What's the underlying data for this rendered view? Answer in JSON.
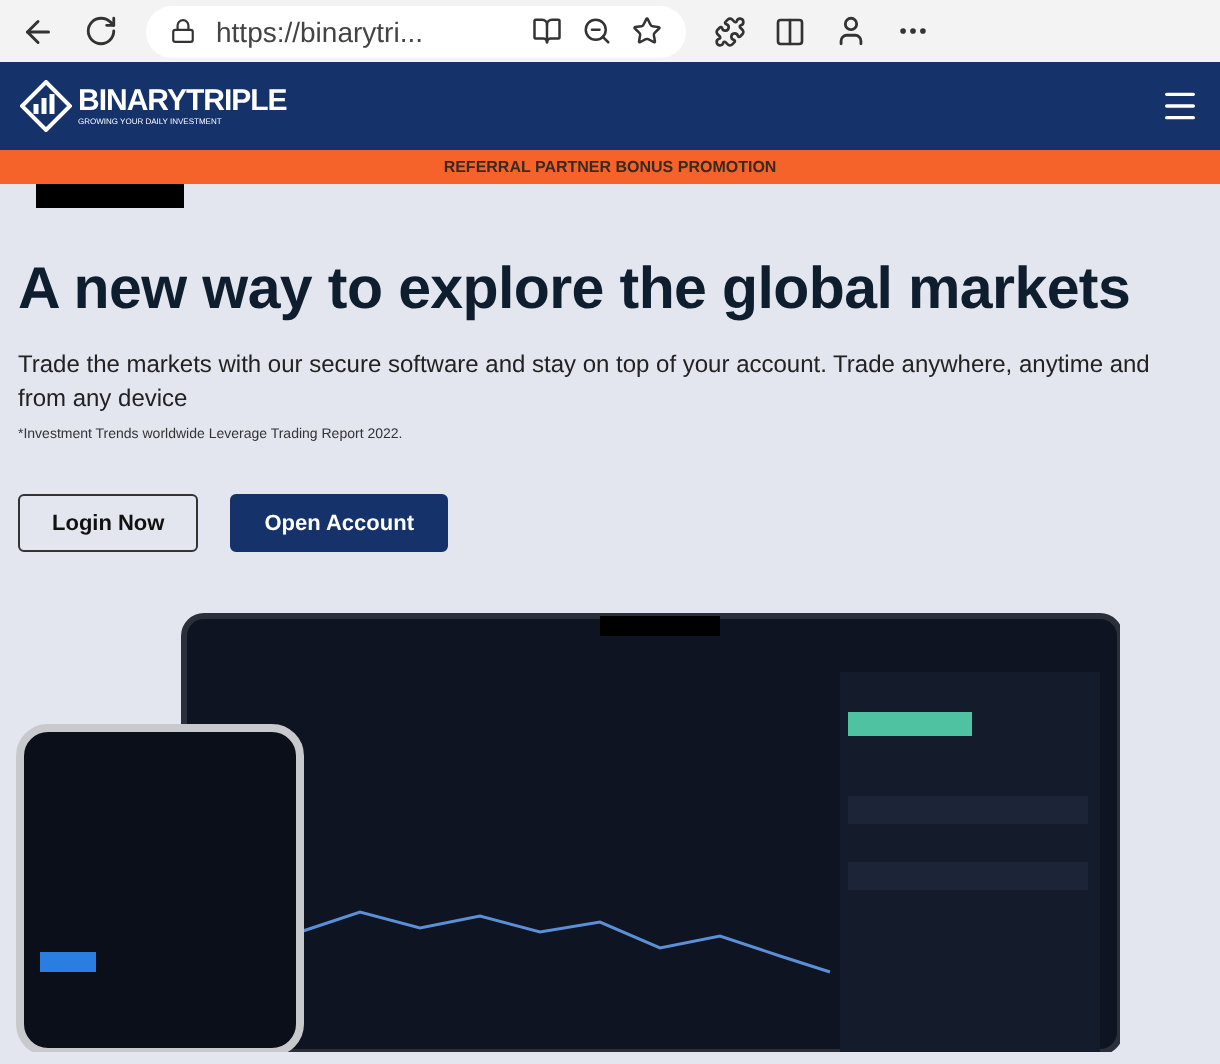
{
  "browser": {
    "url": "https://binarytri..."
  },
  "header": {
    "logo_name": "BINARYTRIPLE",
    "logo_tagline": "GROWING YOUR DAILY INVESTMENT"
  },
  "promo_bar": {
    "text": "REFERRAL PARTNER BONUS PROMOTION"
  },
  "hero": {
    "title": "A new way to explore the global markets",
    "description": "Trade the markets with our secure software and stay on top of your account. Trade anywhere, anytime and from any device",
    "footnote": "*Investment Trends worldwide Leverage Trading Report 2022.",
    "buttons": [
      {
        "label": "Login Now",
        "kind": "outline"
      },
      {
        "label": "Open Account",
        "kind": "solid"
      }
    ]
  }
}
